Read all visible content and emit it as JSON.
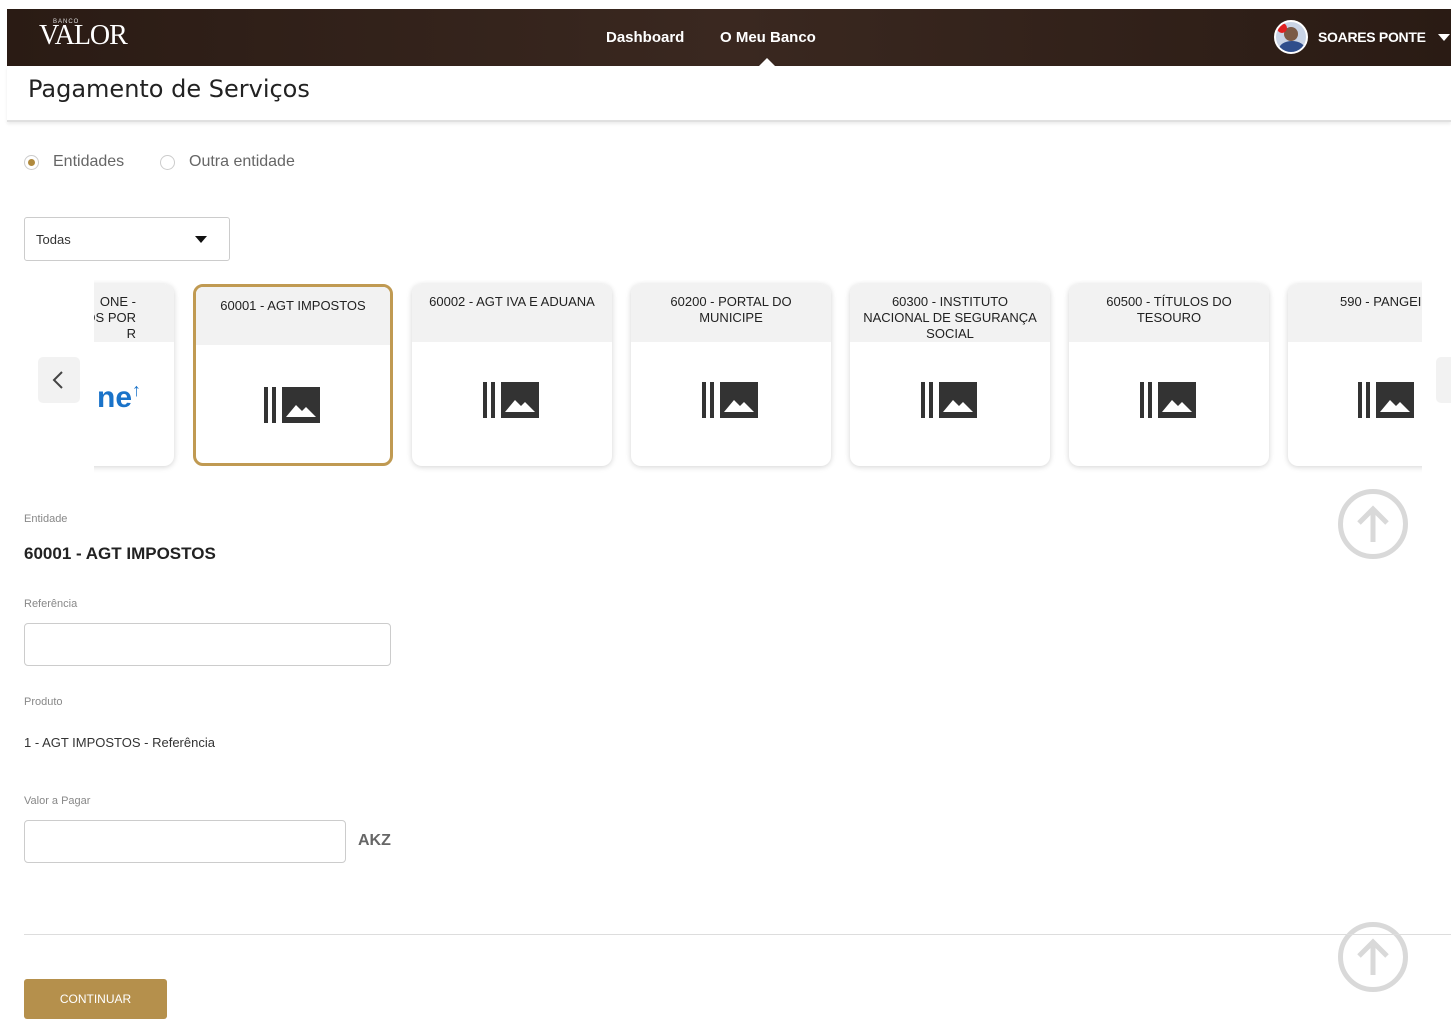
{
  "header": {
    "logo_small": "BANCO",
    "logo_main": "VALOR",
    "nav": [
      "Dashboard",
      "O Meu Banco"
    ],
    "user_name": "SOARES PONTE"
  },
  "page": {
    "title": "Pagamento de Serviços"
  },
  "radio": {
    "options": [
      "Entidades",
      "Outra entidade"
    ],
    "selected": "Entidades"
  },
  "filter": {
    "value": "Todas"
  },
  "carousel": {
    "partial_card": {
      "lines": [
        "ONE -",
        "OS POR",
        "R"
      ],
      "logo_text": "ne"
    },
    "cards": [
      {
        "label": "60001 - AGT IMPOSTOS",
        "selected": true,
        "icon": "image-placeholder-icon"
      },
      {
        "label": "60002 - AGT IVA E ADUANA",
        "icon": "image-placeholder-icon"
      },
      {
        "label": "60200 - PORTAL DO MUNICIPE",
        "icon": "image-placeholder-icon"
      },
      {
        "label": "60300 - INSTITUTO NACIONAL DE SEGURANÇA SOCIAL",
        "icon": "image-placeholder-icon"
      },
      {
        "label": "60500 - TÍTULOS DO TESOURO",
        "icon": "image-placeholder-icon"
      },
      {
        "label": "590 - PANGEI",
        "icon": "image-placeholder-icon"
      }
    ]
  },
  "form": {
    "entidade_label": "Entidade",
    "entidade_value": "60001 - AGT IMPOSTOS",
    "referencia_label": "Referência",
    "referencia_value": "",
    "produto_label": "Produto",
    "produto_value": "1 - AGT IMPOSTOS - Referência",
    "valor_label": "Valor a Pagar",
    "valor_value": "",
    "currency": "AKZ"
  },
  "actions": {
    "continuar": "CONTINUAR"
  },
  "colors": {
    "accent": "#b5904c",
    "header_bg": "#2a1b14"
  }
}
